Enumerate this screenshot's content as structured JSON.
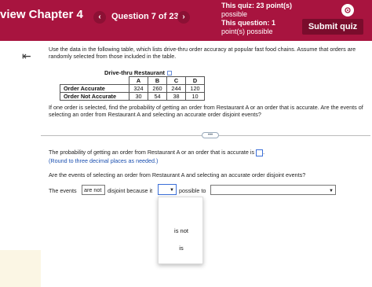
{
  "header": {
    "chapter_title": "view Chapter 4",
    "question_label": "Question 7 of 23",
    "quiz_line1": "This quiz: 23 point(s)",
    "quiz_line2": "possible",
    "question_line1": "This question: 1",
    "question_line2": "point(s) possible",
    "submit_label": "Submit quiz",
    "prev_icon": "chevron-left-icon",
    "next_icon": "chevron-right-icon"
  },
  "question": {
    "intro": "Use the data in the following table, which lists drive-thru order accuracy at popular fast food chains. Assume that orders are randomly selected from those included in the table.",
    "table_caption": "Drive-thru Restaurant",
    "columns": [
      "A",
      "B",
      "C",
      "D"
    ],
    "rows": [
      {
        "label": "Order Accurate",
        "values": [
          "324",
          "260",
          "244",
          "120"
        ]
      },
      {
        "label": "Order Not Accurate",
        "values": [
          "30",
          "54",
          "38",
          "10"
        ]
      }
    ],
    "followup": "If one order is selected, find the probability of getting an order from Restaurant A or an order that is accurate. Are the events of selecting an order from Restaurant A and selecting an accurate order disjoint events?"
  },
  "answer": {
    "part1_text": "The probability of getting an order from Restaurant A or an order that is accurate is",
    "round_note": "(Round to three decimal places as needed.)",
    "part2_text": "Are the events of selecting an order from Restaurant A and selecting an accurate order disjoint events?",
    "events_prefix": "The events",
    "events_selected": "are not",
    "events_middle": "disjoint because it",
    "events_suffix": "possible to",
    "dropdown_options": [
      "is not",
      "is"
    ]
  },
  "colors": {
    "header_bg": "#a8143f",
    "submit_bg": "#7a0c2c",
    "link_blue": "#1a4fb0"
  }
}
